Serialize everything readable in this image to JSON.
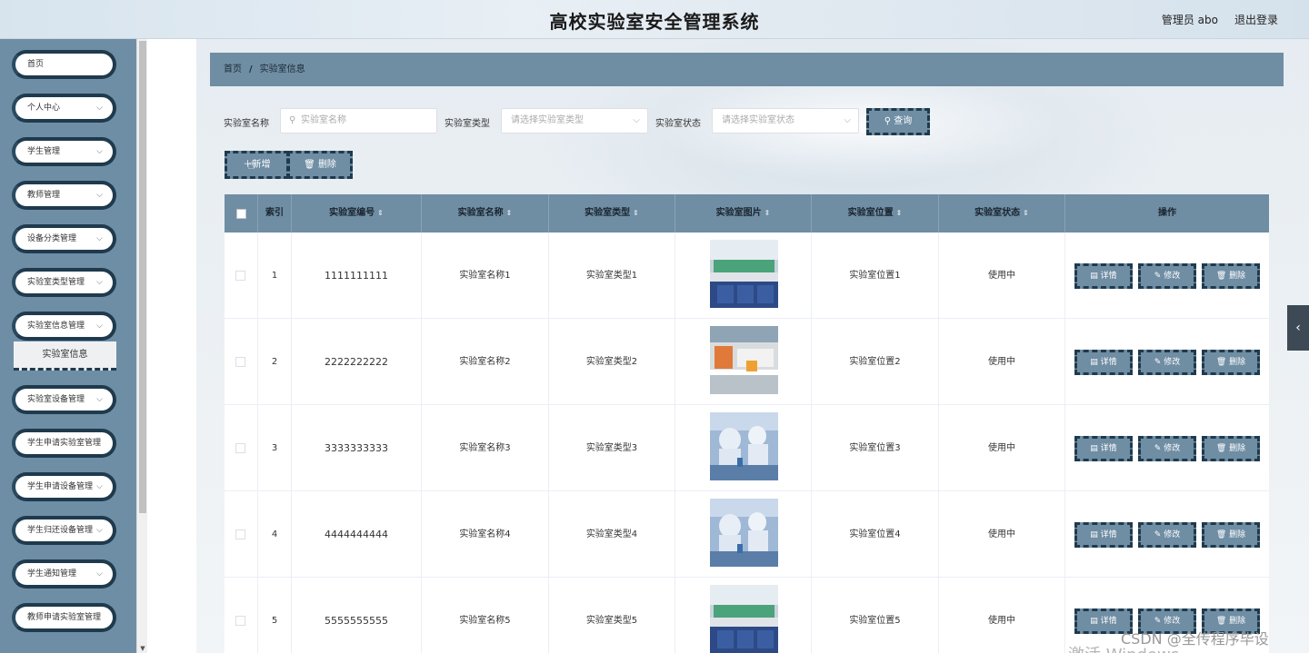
{
  "header": {
    "title": "高校实验室安全管理系统",
    "user": "管理员 abo",
    "logout": "退出登录"
  },
  "sidebar": {
    "items": [
      {
        "label": "首页",
        "chevron": false
      },
      {
        "label": "个人中心",
        "chevron": true
      },
      {
        "label": "学生管理",
        "chevron": true
      },
      {
        "label": "教师管理",
        "chevron": true
      },
      {
        "label": "设备分类管理",
        "chevron": true
      },
      {
        "label": "实验室类型管理",
        "chevron": true
      },
      {
        "label": "实验室信息管理",
        "chevron": true
      },
      {
        "label": "实验室设备管理",
        "chevron": true
      },
      {
        "label": "学生申请实验室管理",
        "chevron": false
      },
      {
        "label": "学生申请设备管理",
        "chevron": true
      },
      {
        "label": "学生归还设备管理",
        "chevron": true
      },
      {
        "label": "学生通知管理",
        "chevron": true
      },
      {
        "label": "教师申请实验室管理",
        "chevron": false
      }
    ],
    "active_sub": "实验室信息"
  },
  "breadcrumb": {
    "home": "首页",
    "sep": "/",
    "current": "实验室信息"
  },
  "search": {
    "name_label": "实验室名称",
    "name_placeholder": "实验室名称",
    "type_label": "实验室类型",
    "type_placeholder": "请选择实验室类型",
    "status_label": "实验室状态",
    "status_placeholder": "请选择实验室状态",
    "query": "查询"
  },
  "toolbar": {
    "add": "新增",
    "delete": "删除"
  },
  "table": {
    "headers": [
      "索引",
      "实验室编号",
      "实验室名称",
      "实验室类型",
      "实验室图片",
      "实验室位置",
      "实验室状态",
      "操作"
    ],
    "rows": [
      {
        "index": "1",
        "code": "1111111111",
        "name": "实验室名称1",
        "type": "实验室类型1",
        "location": "实验室位置1",
        "status": "使用中",
        "img": "lab-green"
      },
      {
        "index": "2",
        "code": "2222222222",
        "name": "实验室名称2",
        "type": "实验室类型2",
        "location": "实验室位置2",
        "status": "使用中",
        "img": "lab-orange"
      },
      {
        "index": "3",
        "code": "3333333333",
        "name": "实验室名称3",
        "type": "实验室类型3",
        "location": "实验室位置3",
        "status": "使用中",
        "img": "lab-blue"
      },
      {
        "index": "4",
        "code": "4444444444",
        "name": "实验室名称4",
        "type": "实验室类型4",
        "location": "实验室位置4",
        "status": "使用中",
        "img": "lab-blue"
      },
      {
        "index": "5",
        "code": "5555555555",
        "name": "实验室名称5",
        "type": "实验室类型5",
        "location": "实验室位置5",
        "status": "使用中",
        "img": "lab-green"
      }
    ],
    "actions": {
      "detail": "详情",
      "edit": "修改",
      "delete": "删除"
    }
  },
  "watermark": {
    "csdn": "CSDN @全传程序毕设",
    "windows": "激活 Windows"
  },
  "colors": {
    "accent": "#6f8da3",
    "dark": "#1f3a4d"
  }
}
